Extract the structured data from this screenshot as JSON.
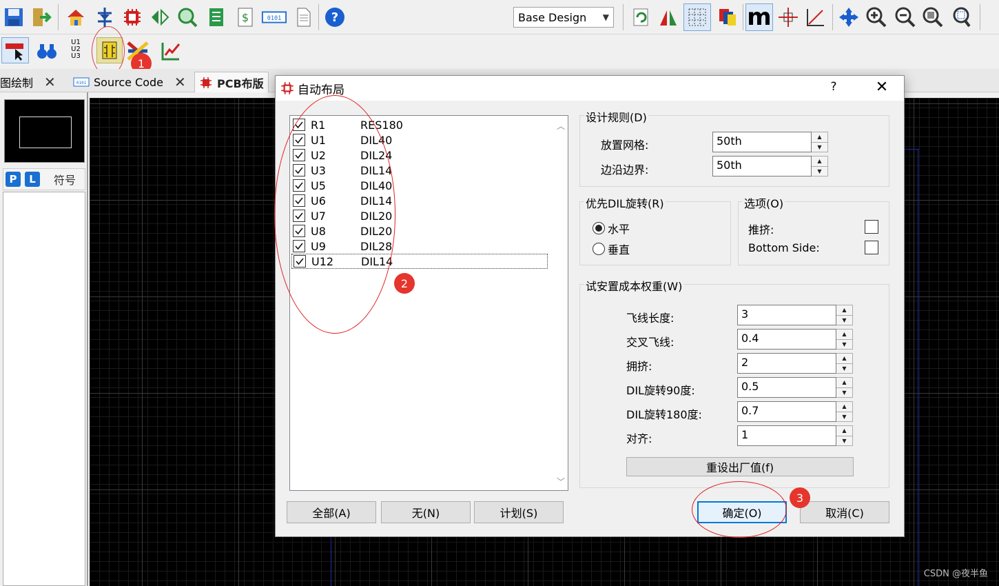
{
  "toolbar": {
    "design_select": "Base Design",
    "icons_row1": [
      "save-icon",
      "exit-icon",
      "home-icon",
      "component-mode-icon",
      "chip-icon",
      "rotate-flip-icon",
      "search-network-icon",
      "netlist-icon",
      "bill-of-materials-icon",
      "binary-code-icon",
      "document-icon",
      "help-icon"
    ],
    "icons_row2": [
      "select-area-icon",
      "binoculars-icon",
      "auto-annotate-icon",
      "auto-placement-icon",
      "auto-router-icon",
      "design-rule-icon"
    ],
    "u_labels": [
      "U1",
      "U2",
      "U3"
    ],
    "right_icons": [
      "refresh-icon",
      "flip-icon",
      "grid-icon",
      "layers-icon",
      "metric-icon",
      "origin-icon",
      "axis-icon",
      "pan-icon",
      "zoom-in-icon",
      "zoom-out-icon",
      "zoom-fit-icon",
      "zoom-area-icon"
    ],
    "metric_label": "m"
  },
  "tabs": [
    {
      "label": "图绘制",
      "closable": true
    },
    {
      "label": "Source Code",
      "closable": true
    },
    {
      "label": "PCB布版",
      "closable": false
    }
  ],
  "left_panel": {
    "p_label": "P",
    "l_label": "L",
    "symbol_label": "符号"
  },
  "dialog": {
    "title": "自动布局",
    "help": "?",
    "close": "✕",
    "components": [
      {
        "ref": "R1",
        "package": "RES180",
        "checked": true
      },
      {
        "ref": "U1",
        "package": "DIL40",
        "checked": true
      },
      {
        "ref": "U2",
        "package": "DIL24",
        "checked": true
      },
      {
        "ref": "U3",
        "package": "DIL14",
        "checked": true
      },
      {
        "ref": "U5",
        "package": "DIL40",
        "checked": true
      },
      {
        "ref": "U6",
        "package": "DIL14",
        "checked": true
      },
      {
        "ref": "U7",
        "package": "DIL20",
        "checked": true
      },
      {
        "ref": "U8",
        "package": "DIL20",
        "checked": true
      },
      {
        "ref": "U9",
        "package": "DIL28",
        "checked": true
      },
      {
        "ref": "U12",
        "package": "DIL14",
        "checked": true
      }
    ],
    "buttons": {
      "all": "全部(A)",
      "none": "无(N)",
      "plan": "计划(S)",
      "ok": "确定(O)",
      "cancel": "取消(C)",
      "reset": "重设出厂值(f)"
    },
    "design_rules": {
      "title": "设计规则(D)",
      "placement_grid_label": "放置网格:",
      "placement_grid_value": "50th",
      "edge_border_label": "边沿边界:",
      "edge_border_value": "50th"
    },
    "dil_rotation": {
      "title": "优先DIL旋转(R)",
      "horizontal": "水平",
      "vertical": "垂直",
      "selected": "horizontal"
    },
    "options": {
      "title": "选项(O)",
      "push_label": "推挤:",
      "bottom_side_label": "Bottom Side:",
      "push_checked": false,
      "bottom_side_checked": false
    },
    "cost_weights": {
      "title": "试安置成本权重(W)",
      "rows": [
        {
          "label": "飞线长度:",
          "value": "3"
        },
        {
          "label": "交叉飞线:",
          "value": "0.4"
        },
        {
          "label": "拥挤:",
          "value": "2"
        },
        {
          "label": "DIL旋转90度:",
          "value": "0.5"
        },
        {
          "label": "DIL旋转180度:",
          "value": "0.7"
        },
        {
          "label": "对齐:",
          "value": "1"
        }
      ]
    }
  },
  "annotations": {
    "badge1": "1",
    "badge2": "2",
    "badge3": "3",
    "color": "#e5352c"
  },
  "watermark": "CSDN @夜半鱼"
}
